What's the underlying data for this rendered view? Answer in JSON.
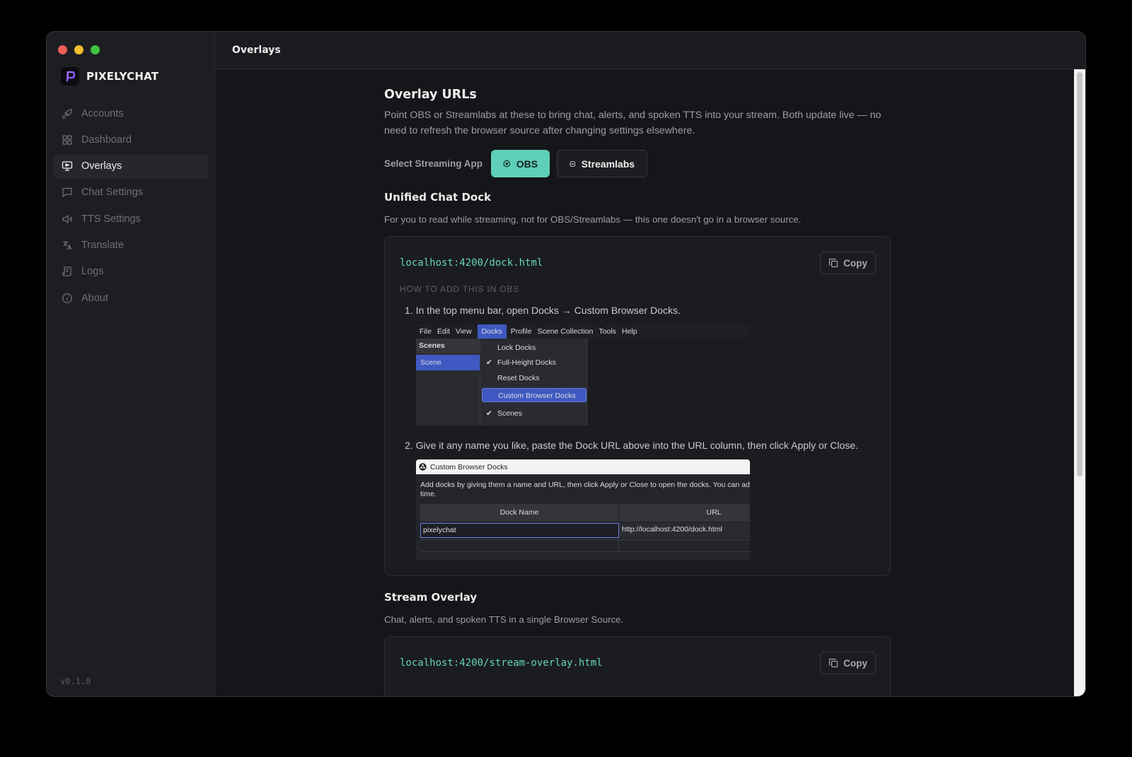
{
  "app": {
    "name": "PIXELYCHAT",
    "version": "v0.1.0"
  },
  "header": {
    "title": "Overlays"
  },
  "sidebar": {
    "items": [
      {
        "label": "Accounts",
        "icon": "rocket-icon",
        "active": false
      },
      {
        "label": "Dashboard",
        "icon": "grid-icon",
        "active": false
      },
      {
        "label": "Overlays",
        "icon": "monitor-icon",
        "active": true
      },
      {
        "label": "Chat Settings",
        "icon": "chat-icon",
        "active": false
      },
      {
        "label": "TTS Settings",
        "icon": "speaker-icon",
        "active": false
      },
      {
        "label": "Translate",
        "icon": "translate-icon",
        "active": false
      },
      {
        "label": "Logs",
        "icon": "scroll-icon",
        "active": false
      },
      {
        "label": "About",
        "icon": "info-icon",
        "active": false
      }
    ]
  },
  "page": {
    "title": "Overlay URLs",
    "description": "Point OBS or Streamlabs at these to bring chat, alerts, and spoken TTS into your stream. Both update live — no need to refresh the browser source after changing settings elsewhere.",
    "select_label": "Select Streaming App",
    "apps": [
      {
        "label": "OBS",
        "selected": true
      },
      {
        "label": "Streamlabs",
        "selected": false
      }
    ]
  },
  "dock": {
    "title": "Unified Chat Dock",
    "description": "For you to read while streaming, not for OBS/Streamlabs — this one doesn't go in a browser source.",
    "url": "localhost:4200/dock.html",
    "copy_label": "Copy",
    "howto_label": "HOW TO ADD THIS IN OBS",
    "step1": "1. In the top menu bar, open Docks → Custom Browser Docks.",
    "step2": "2. Give it any name you like, paste the Dock URL above into the URL column, then click Apply or Close.",
    "mock_menu": {
      "menubar": [
        "File",
        "Edit",
        "View",
        "Docks",
        "Profile",
        "Scene Collection",
        "Tools",
        "Help"
      ],
      "scenes_header": "Scenes",
      "scene": "Scene",
      "dropdown": [
        {
          "label": "Lock Docks",
          "checked": false
        },
        {
          "label": "Full-Height Docks",
          "checked": true
        },
        {
          "label": "Reset Docks",
          "checked": false
        },
        {
          "label": "Custom Browser Docks",
          "checked": false
        },
        {
          "label": "Scenes",
          "checked": true
        }
      ]
    },
    "mock_dialog": {
      "title": "Custom Browser Docks",
      "desc_line1": "Add docks by giving them a name and URL, then click Apply or Close to open the docks. You can add c",
      "desc_line2": "time.",
      "col_name": "Dock Name",
      "col_url": "URL",
      "row_name": "pixelychat",
      "row_url": "http://localhost:4200/dock.html"
    }
  },
  "overlay": {
    "title": "Stream Overlay",
    "description": "Chat, alerts, and spoken TTS in a single Browser Source.",
    "url": "localhost:4200/stream-overlay.html",
    "copy_label": "Copy"
  },
  "colors": {
    "accent": "#5fcfb9",
    "url_text": "#63d3bd",
    "menu_highlight": "#3f59c2"
  }
}
